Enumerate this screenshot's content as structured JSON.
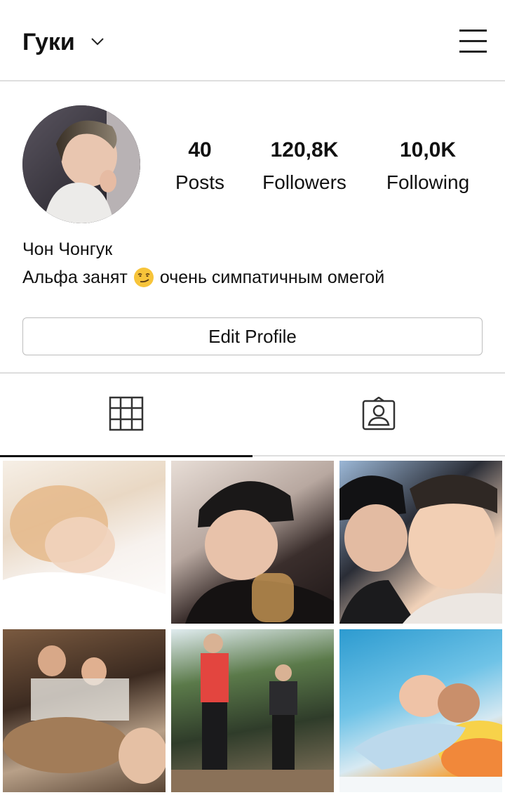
{
  "header": {
    "username": "Гуки",
    "icons": {
      "dropdown": "chevron-down-icon",
      "menu": "hamburger-menu-icon"
    }
  },
  "profile": {
    "full_name": "Чон Чонгук",
    "bio_before_emoji": "Альфа занят",
    "bio_emoji": "smirking-face-emoji",
    "bio_after_emoji": "очень симпатичным омегой",
    "avatar": "profile-photo"
  },
  "stats": {
    "posts": {
      "value": "40",
      "label": "Posts"
    },
    "followers": {
      "value": "120,8K",
      "label": "Followers"
    },
    "following": {
      "value": "10,0K",
      "label": "Following"
    }
  },
  "edit_profile_label": "Edit Profile",
  "tabs": [
    {
      "icon": "grid-icon",
      "active": true
    },
    {
      "icon": "tagged-person-icon",
      "active": false
    }
  ],
  "posts": [
    {
      "description": "photo"
    },
    {
      "description": "photo"
    },
    {
      "description": "photo"
    },
    {
      "description": "photo"
    },
    {
      "description": "photo"
    },
    {
      "description": "photo"
    }
  ]
}
